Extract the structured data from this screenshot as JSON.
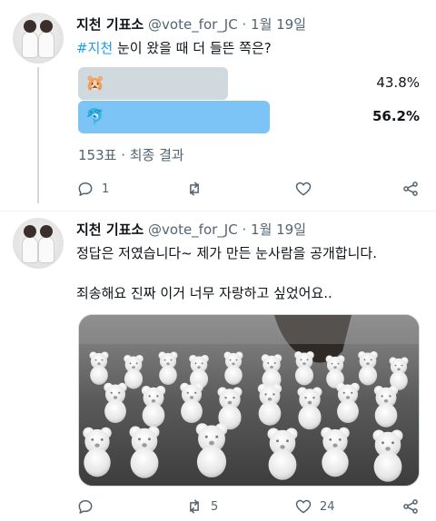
{
  "tweets": [
    {
      "display_name": "지천 기표소",
      "handle": "@vote_for_JC",
      "date": "· 1월 19일",
      "hashtag": "#지천",
      "text": " 눈이 왔을 때 더 들뜬 쪽은?",
      "poll": {
        "options": [
          {
            "emoji": "🐹",
            "percent": "43.8%",
            "fraction": 0.438,
            "winner": false
          },
          {
            "emoji": "🐬",
            "percent": "56.2%",
            "fraction": 0.562,
            "winner": true
          }
        ],
        "summary": "153표 · 최종 결과"
      },
      "actions": {
        "reply_count": "1",
        "retweet_count": "",
        "like_count": ""
      }
    },
    {
      "display_name": "지천 기표소",
      "handle": "@vote_for_JC",
      "date": "· 1월 19일",
      "line1": "정답은 저였습니다~ 제가 만든 눈사람을 공개합니다.",
      "line2": "죄송해요 진짜 이거 너무 자랑하고 싶었어요..",
      "actions": {
        "reply_count": "",
        "retweet_count": "5",
        "like_count": "24"
      }
    }
  ],
  "colors": {
    "accent": "#1d9bf0",
    "winner_bar": "#7cc4f5",
    "loser_bar": "#cfd9de",
    "secondary_text": "#536471"
  },
  "icons": [
    "reply-icon",
    "retweet-icon",
    "like-icon",
    "share-icon"
  ]
}
